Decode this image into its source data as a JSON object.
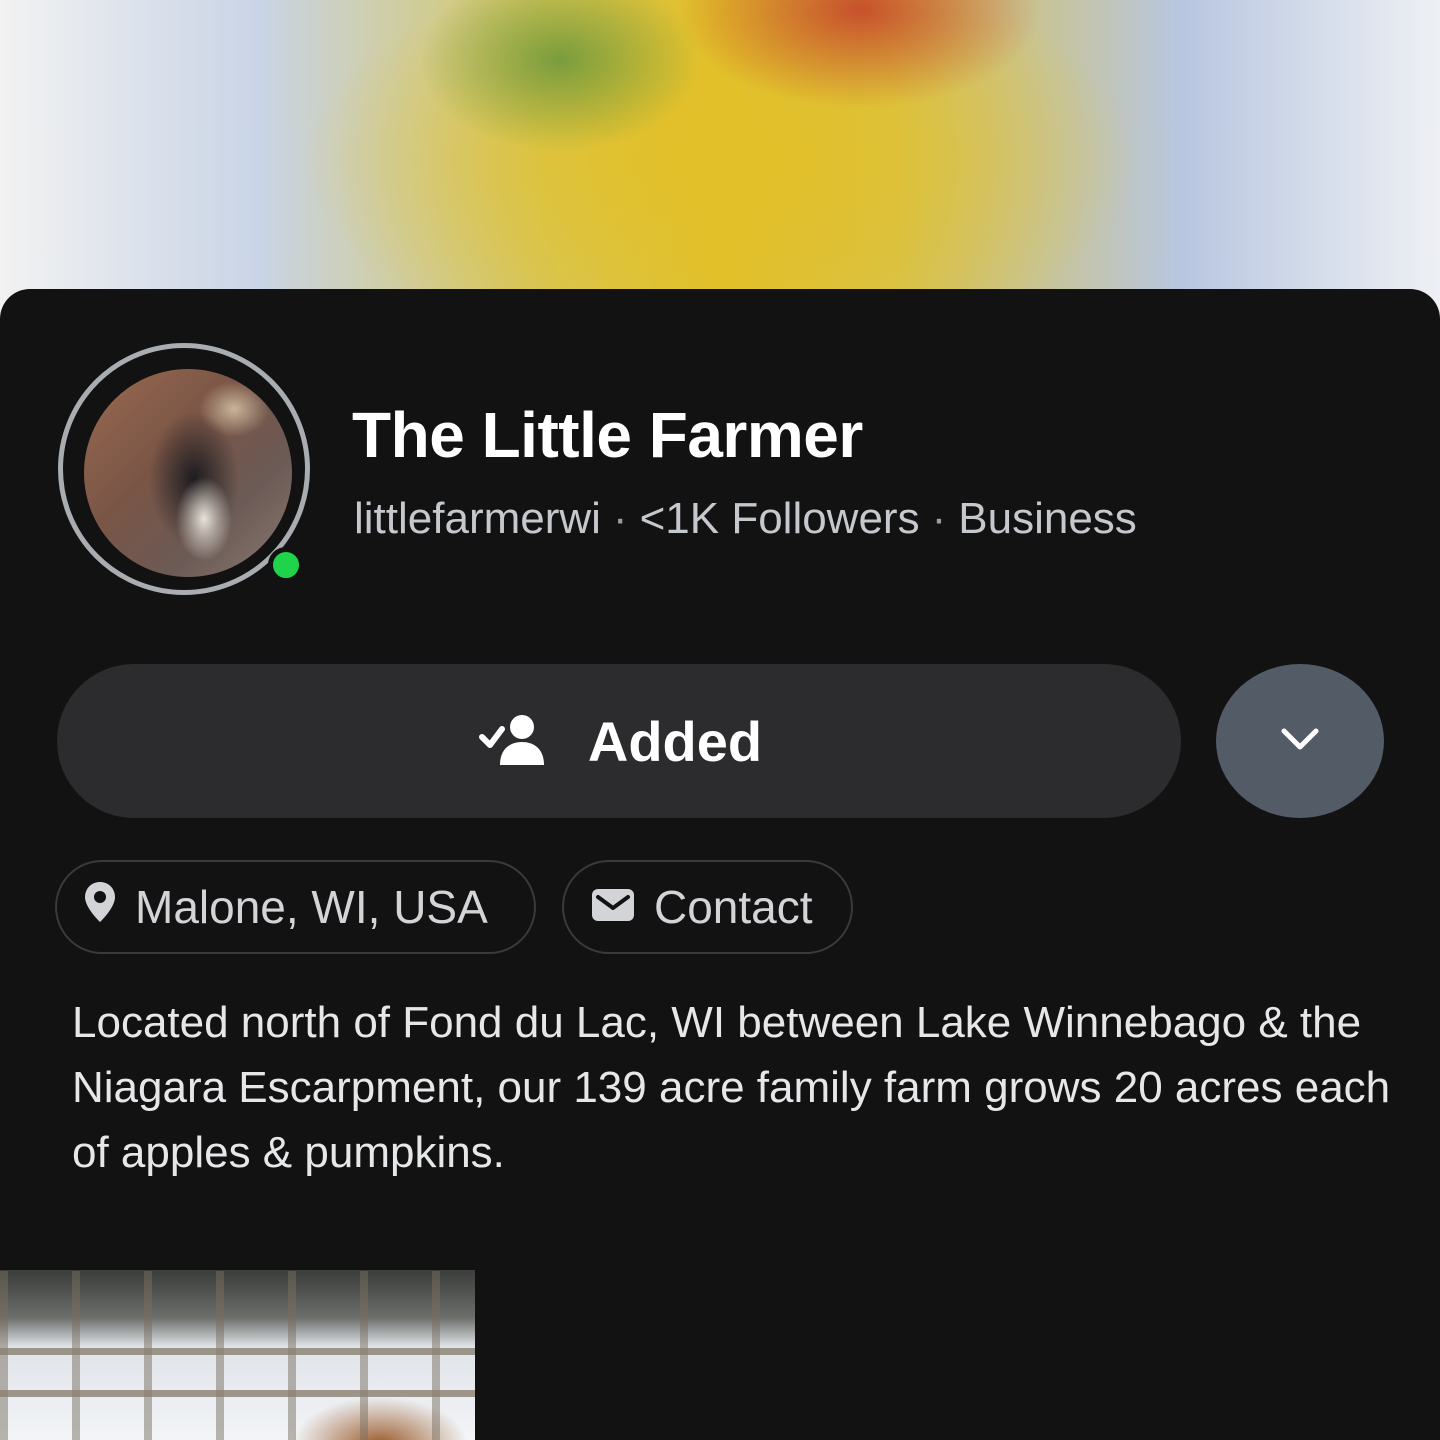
{
  "profile": {
    "name": "The Little Farmer",
    "username": "littlefarmerwi",
    "followers": "<1K Followers",
    "account_type": "Business",
    "separator": "·",
    "online": true
  },
  "actions": {
    "added_label": "Added"
  },
  "chips": {
    "location": "Malone, WI, USA",
    "contact": "Contact"
  },
  "bio": "Located north of Fond du Lac, WI between Lake Winnebago & the Niagara Escarpment, our 139 acre family farm grows 20 acres each of apples & pumpkins.",
  "colors": {
    "background": "#121212",
    "online": "#1fd34a",
    "button": "#2c2c2e",
    "more_button": "#535c66"
  },
  "icons": [
    "user-check-icon",
    "chevron-down-icon",
    "location-pin-icon",
    "mail-icon"
  ]
}
